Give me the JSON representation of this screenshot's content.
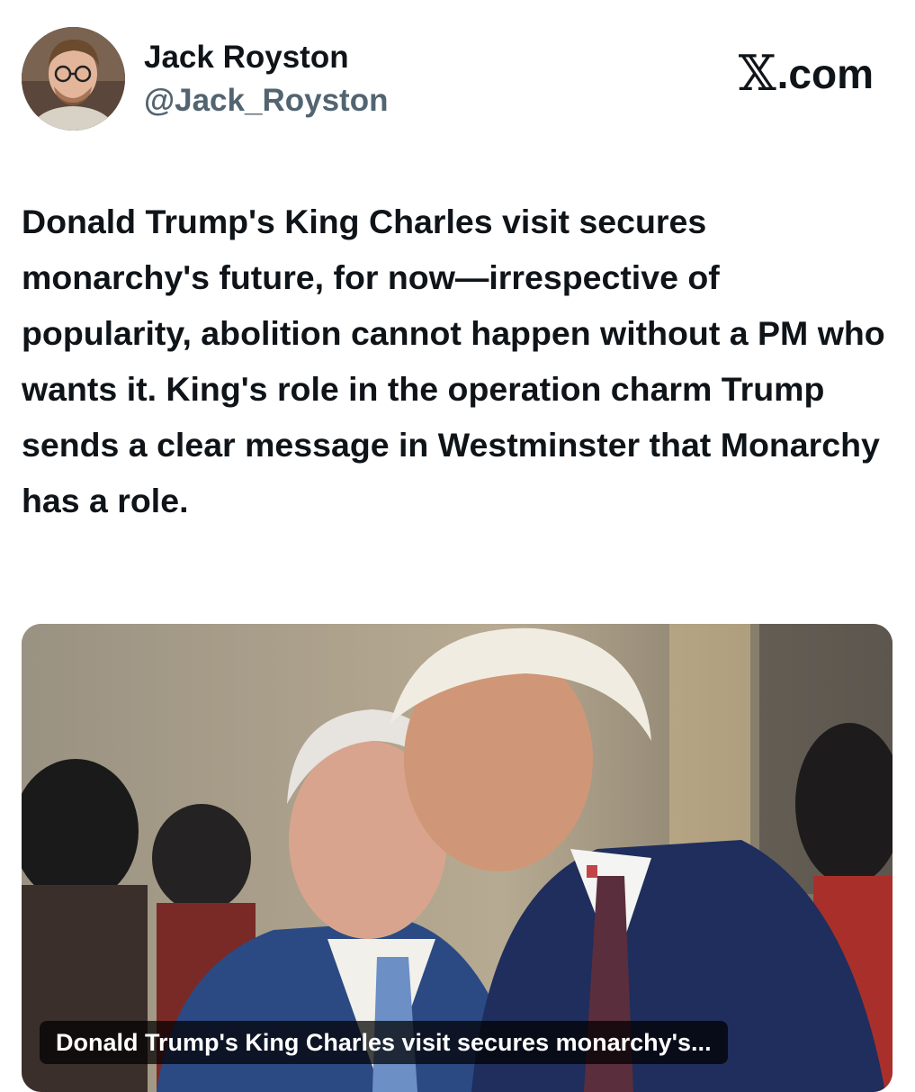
{
  "author": {
    "name": "Jack Royston",
    "handle": "@Jack_Royston"
  },
  "brand": {
    "logo_icon": "x-logo-icon",
    "suffix": ".com"
  },
  "tweet": {
    "text": "Donald Trump's King Charles visit secures monarchy's future, for now—irrespective of popularity, abolition cannot happen without a PM who wants it. King's role in the operation charm Trump sends a clear message in Westminster that Monarchy has a role."
  },
  "media": {
    "caption": "Donald Trump's King Charles visit secures monarchy's..."
  },
  "colors": {
    "text_primary": "#0f1419",
    "text_secondary": "#536471",
    "background": "#ffffff"
  }
}
